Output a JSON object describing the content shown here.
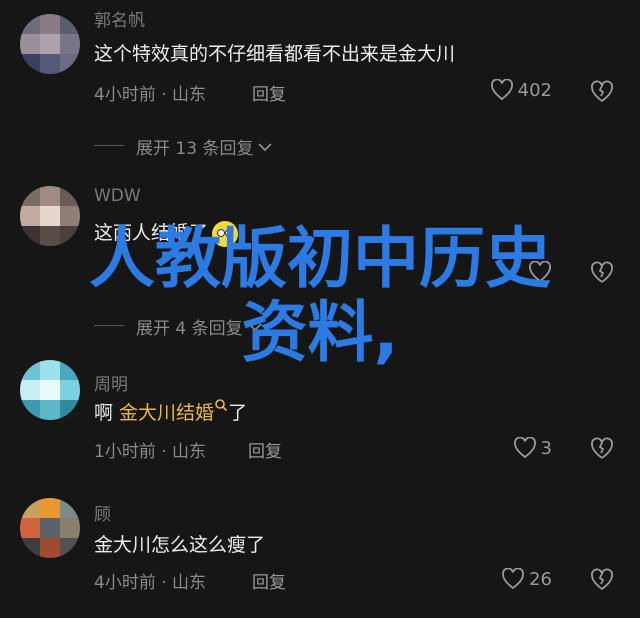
{
  "comments": [
    {
      "username": "郭名帆",
      "text": "这个特效真的不仔细看都看不出来是金大川",
      "time_location": "4小时前 · 山东",
      "reply_label": "回复",
      "likes": "402",
      "expand": "展开 13 条回复"
    },
    {
      "username": "WDW",
      "text": "这两人结婚了",
      "time_location": "",
      "reply_label": "",
      "likes": "",
      "expand": "展开 4 条回复"
    },
    {
      "username": "周明",
      "text_prefix": "啊 ",
      "mention": "金大川结婚",
      "text_suffix": "了",
      "time_location": "1小时前 · 山东",
      "reply_label": "回复",
      "likes": "3"
    },
    {
      "username": "顾",
      "text": "金大川怎么这么瘦了",
      "time_location": "4小时前 · 山东",
      "reply_label": "回复",
      "likes": "26"
    }
  ],
  "overlay_title": {
    "line1": "人教版初中历史",
    "line2": "资料,"
  },
  "icons": {
    "like": "heart-outline-icon",
    "dislike": "broken-heart-icon",
    "expand": "chevron-down-icon"
  },
  "colors": {
    "background": "#161616",
    "overlay_text": "#2c7be5",
    "mention": "#e8b84a"
  }
}
